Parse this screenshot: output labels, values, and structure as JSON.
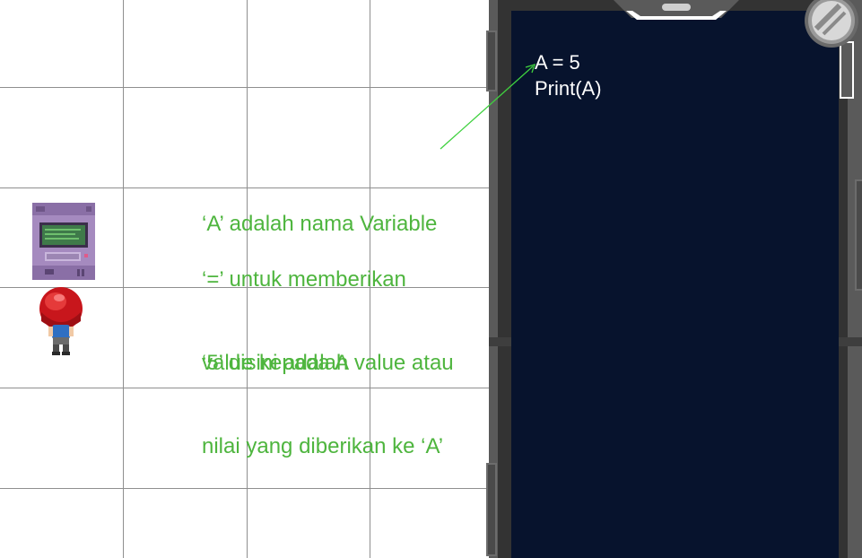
{
  "annotations": [
    {
      "lines": [
        "‘A’ adalah nama Variable"
      ]
    },
    {
      "lines": [
        "‘=’ untuk memberikan",
        "value kepada A"
      ]
    },
    {
      "lines": [
        "‘5’ disini adalah value atau",
        "nilai yang diberikan ke ‘A’"
      ]
    }
  ],
  "code_screen": {
    "lines": [
      "A = 5",
      "Print(A)"
    ]
  },
  "colors": {
    "annotation_text": "#4eb53e",
    "arrow": "#3fd13f",
    "screen_bg": "#07132d",
    "device_frame": "#5a5a5a",
    "grid_line": "#8f8f8f",
    "code_text": "#ffffff"
  },
  "icons": {
    "computer": "retro-computer-icon",
    "player": "red-haired-player-icon",
    "lens": "camera-lens-icon"
  }
}
